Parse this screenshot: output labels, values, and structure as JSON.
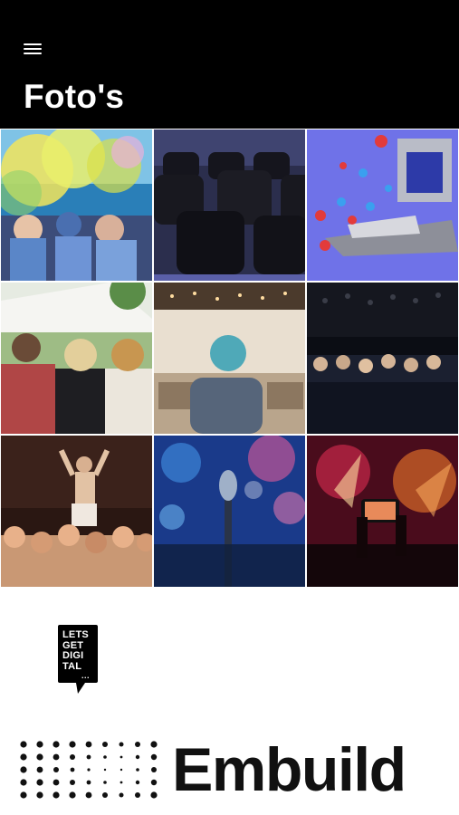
{
  "header": {
    "menu_icon": "hamburger-menu-icon",
    "title": "Foto's"
  },
  "gallery": {
    "photos": [
      {
        "subject": "color powder festival crowd"
      },
      {
        "subject": "empty auditorium chairs"
      },
      {
        "subject": "virtual stage with reactions"
      },
      {
        "subject": "festival audience outdoors"
      },
      {
        "subject": "woman speaking in conference hall"
      },
      {
        "subject": "seated audience in dark room"
      },
      {
        "subject": "crowd surfing at concert"
      },
      {
        "subject": "microphone with bokeh lights"
      },
      {
        "subject": "phone filming concert"
      }
    ]
  },
  "sponsors": {
    "lgd": {
      "text": "LETS GET DIGI TAL",
      "dots": "..."
    },
    "embuild": {
      "name": "Embuild"
    }
  },
  "colors": {
    "header_bg": "#000000",
    "title": "#ffffff",
    "embuild": "#111111"
  }
}
